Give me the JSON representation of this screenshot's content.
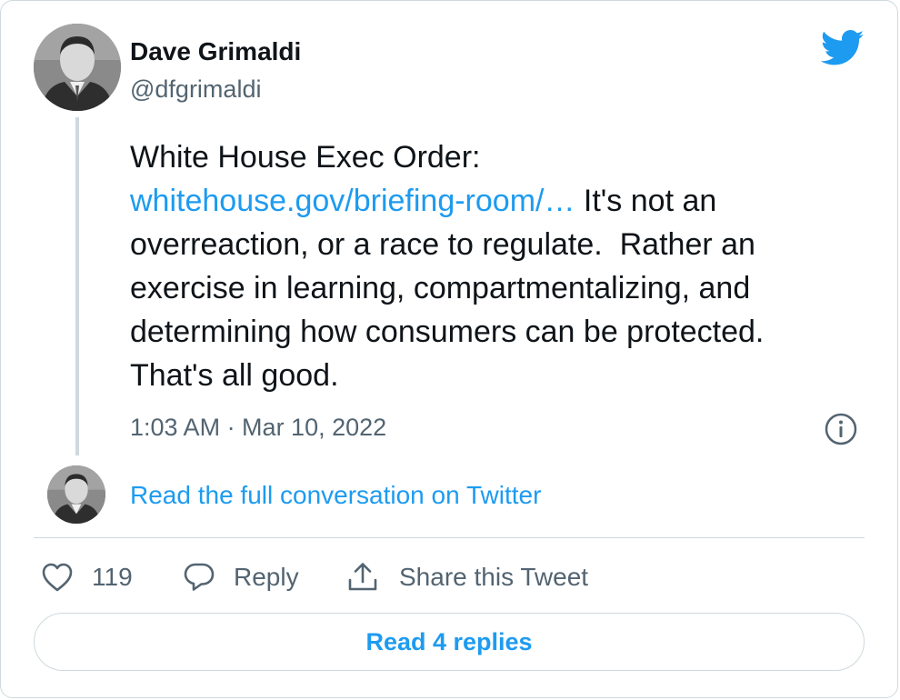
{
  "author": {
    "name": "Dave Grimaldi",
    "handle": "@dfgrimaldi"
  },
  "tweet": {
    "line1": "White House Exec Order:",
    "link": "whitehouse.gov/briefing-room/…",
    "line2_rest": " It's not an",
    "line3": "overreaction, or a race to regulate.  Rather an",
    "line4": "exercise in learning, compartmentalizing, and",
    "line5": "determining how consumers can be protected.",
    "line6": "That's all good.",
    "timestamp": "1:03 AM · Mar 10, 2022"
  },
  "conversation_link": "Read the full conversation on Twitter",
  "actions": {
    "like_count": "119",
    "reply_label": "Reply",
    "share_label": "Share this Tweet"
  },
  "replies_button": "Read 4 replies",
  "colors": {
    "accent": "#1d9bf0",
    "secondary_text": "#536471",
    "primary_text": "#0f1419",
    "border": "#cfd9de"
  },
  "icons": {
    "brand": "twitter-bird-icon",
    "info": "info-icon",
    "like": "heart-icon",
    "reply": "speech-bubble-icon",
    "share": "share-upload-icon"
  }
}
